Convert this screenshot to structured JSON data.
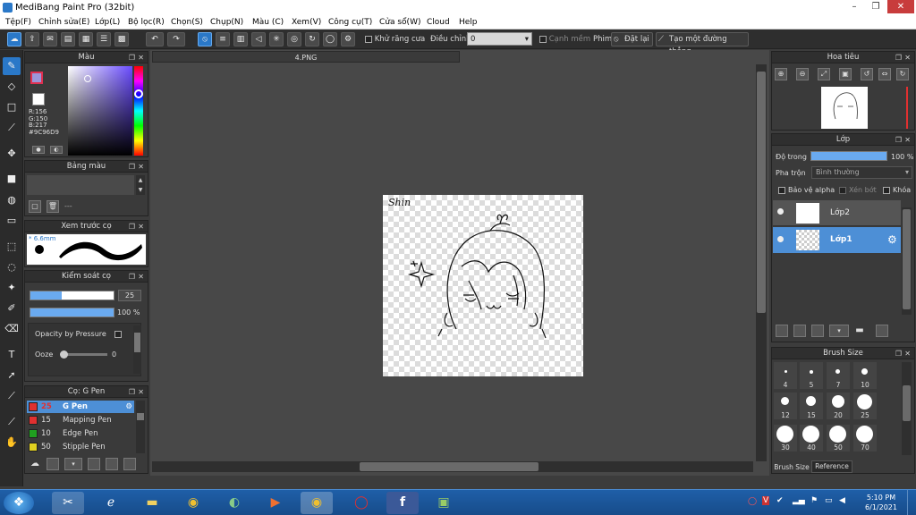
{
  "window": {
    "title": "MediBang Paint Pro (32bit)",
    "controls": [
      "–",
      "❐",
      "✕"
    ]
  },
  "menu": [
    "Tệp(F)",
    "Chỉnh sửa(E)",
    "Lớp(L)",
    "Bộ lọc(R)",
    "Chọn(S)",
    "Chụp(N)",
    "Màu (C)",
    "Xem(V)",
    "Công cụ(T)",
    "Cửa sổ(W)",
    "Cloud",
    "Help"
  ],
  "toolbar": {
    "antialias_label": "Khử răng cưa",
    "adjust_label": "Điều chỉnh",
    "adjust_value": "0",
    "snap_label": "Cạnh mềm",
    "snap_prefix": "Phim",
    "reset_label": "Đặt lại",
    "create_line_label": "Tạo một đường thẳng"
  },
  "color_panel": {
    "title": "Màu",
    "r": "R:156",
    "g": "G:150",
    "b": "B:217",
    "hex": "#9C96D9",
    "colors": {
      "primary": "#9c96d9",
      "accent": "#2a78c8"
    }
  },
  "palette_panel": {
    "title": "Bảng màu",
    "dash": "---"
  },
  "preview_panel": {
    "title": "Xem trước cọ",
    "size_label": "* 6.6mm"
  },
  "control_panel": {
    "title": "Kiểm soát cọ",
    "size_value": "25",
    "size_level": 0.38,
    "opacity_value": "100 %",
    "opacity_level": 1.0,
    "pressure_label": "Opacity by Pressure",
    "ooze_label": "Ooze",
    "ooze_value": "0"
  },
  "brush_panel": {
    "title": "Cọ: G Pen",
    "brushes": [
      {
        "size": "25",
        "name": "G Pen",
        "color": "#e03030",
        "selected": true
      },
      {
        "size": "15",
        "name": "Mapping Pen",
        "color": "#e03030",
        "selected": false
      },
      {
        "size": "10",
        "name": "Edge Pen",
        "color": "#20a020",
        "selected": false
      },
      {
        "size": "50",
        "name": "Stipple Pen",
        "color": "#e0d020",
        "selected": false
      }
    ]
  },
  "document": {
    "tab_title": "4.PNG",
    "signature": "Shin"
  },
  "navigator_panel": {
    "title": "Hoa tiêu"
  },
  "layer_panel": {
    "title": "Lớp",
    "opacity_label": "Độ trong",
    "opacity_value": "100 %",
    "opacity_level": 1.0,
    "blend_label": "Pha trộn",
    "blend_value": "Bình thường",
    "protect_alpha": "Bảo vệ alpha",
    "clipping": "Xén bớt",
    "lock": "Khóa",
    "layers": [
      {
        "name": "Lớp2",
        "selected": false
      },
      {
        "name": "Lớp1",
        "selected": true
      }
    ]
  },
  "brushsize_panel": {
    "title": "Brush Size",
    "sizes": [
      "4",
      "5",
      "7",
      "10",
      "12",
      "15",
      "20",
      "25",
      "30",
      "40",
      "50",
      "70"
    ],
    "tabs": [
      "Brush Size",
      "Reference"
    ]
  },
  "taskbar": {
    "time": "5:10 PM",
    "date": "6/1/2021"
  }
}
